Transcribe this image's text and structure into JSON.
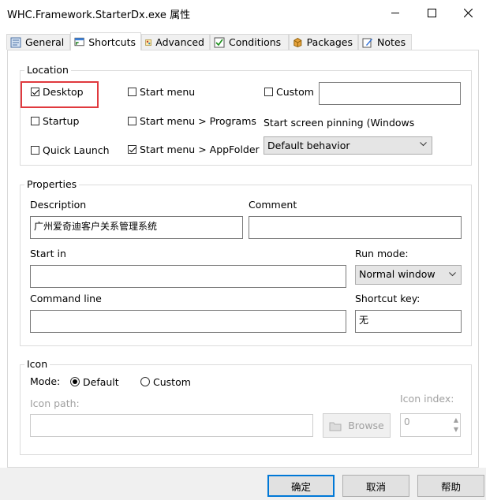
{
  "window": {
    "title": "WHC.Framework.StarterDx.exe 属性"
  },
  "tabs": [
    {
      "label": "General",
      "icon": "general-icon"
    },
    {
      "label": "Shortcuts",
      "icon": "shortcuts-icon"
    },
    {
      "label": "Advanced",
      "icon": "advanced-icon"
    },
    {
      "label": "Conditions",
      "icon": "conditions-icon"
    },
    {
      "label": "Packages",
      "icon": "packages-icon"
    },
    {
      "label": "Notes",
      "icon": "notes-icon"
    }
  ],
  "location": {
    "legend": "Location",
    "desktop": "Desktop",
    "startup": "Startup",
    "quick_launch": "Quick Launch",
    "start_menu": "Start menu",
    "start_menu_programs": "Start menu > Programs",
    "start_menu_appfolder": "Start menu > AppFolder",
    "custom": "Custom",
    "custom_value": "",
    "pinning_label": "Start screen pinning (Windows",
    "pinning_value": "Default behavior"
  },
  "properties": {
    "legend": "Properties",
    "description_label": "Description",
    "description_value": "广州爱奇迪客户关系管理系统",
    "comment_label": "Comment",
    "comment_value": "",
    "start_in_label": "Start in",
    "start_in_value": "",
    "run_mode_label": "Run mode:",
    "run_mode_value": "Normal window",
    "command_line_label": "Command line",
    "command_line_value": "",
    "shortcut_key_label": "Shortcut key:",
    "shortcut_key_value": "无"
  },
  "icon": {
    "legend": "Icon",
    "mode_label": "Mode:",
    "mode_default": "Default",
    "mode_custom": "Custom",
    "icon_path_label": "Icon path:",
    "icon_path_value": "",
    "browse_label": "Browse",
    "icon_index_label": "Icon index:",
    "icon_index_value": "0"
  },
  "footer": {
    "ok": "确定",
    "cancel": "取消",
    "help": "帮助"
  },
  "colors": {
    "highlight": "#e0393e",
    "default_button_border": "#0078d7"
  }
}
